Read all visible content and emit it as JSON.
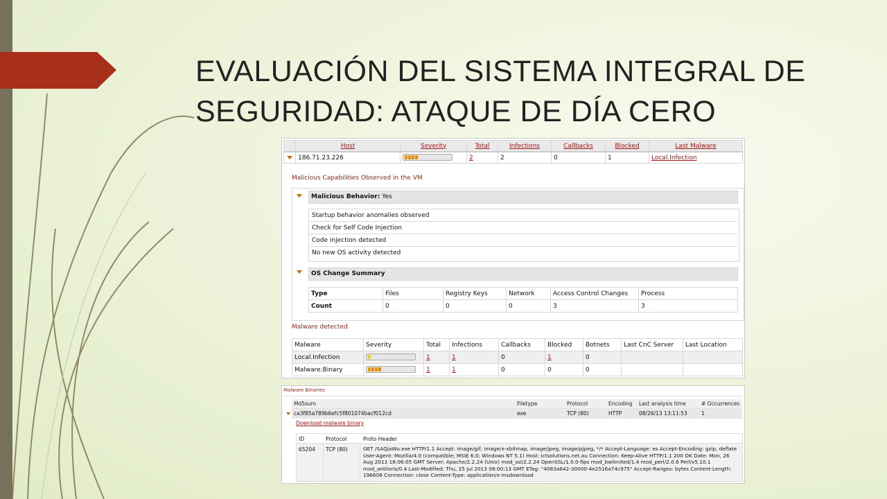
{
  "slide": {
    "title": "EVALUACIÓN DEL SISTEMA INTEGRAL DE SEGURIDAD: ATAQUE DE DÍA CERO",
    "accent_color": "#a8301a",
    "bar_color": "#77705a"
  },
  "host_table": {
    "headers": [
      "Host",
      "Severity",
      "Total",
      "Infections",
      "Callbacks",
      "Blocked",
      "Last Malware"
    ],
    "row": {
      "host": "186.71.23.226",
      "severity_level": 4,
      "total": "2",
      "infections": "2",
      "callbacks": "0",
      "blocked": "1",
      "last_malware": "Local.Infection"
    }
  },
  "malicious_section": {
    "label": "Malicious Capabilities Observed in the VM",
    "behavior_title": "Malicious Behavior:",
    "behavior_value": "Yes",
    "items": [
      "Startup behavior anomalies observed",
      "Check for Self Code Injection",
      "Code injection detected",
      "No new OS activity detected"
    ],
    "os_title": "OS Change Summary",
    "os_headers": [
      "Type",
      "Files",
      "Registry Keys",
      "Network",
      "Access Control Changes",
      "Process"
    ],
    "os_values": [
      "Count",
      "0",
      "0",
      "0",
      "3",
      "3"
    ]
  },
  "malware_section": {
    "label": "Malware detected",
    "headers": [
      "Malware",
      "Severity",
      "Total",
      "Infections",
      "Callbacks",
      "Blocked",
      "Botnets",
      "Last CnC Server",
      "Last Location"
    ],
    "rows": [
      {
        "malware": "Local.Infection",
        "severity_level": 1,
        "total": "1",
        "infections": "1",
        "callbacks": "0",
        "blocked": "1",
        "botnets": "0"
      },
      {
        "malware": "Malware.Binary",
        "severity_level": 4,
        "total": "1",
        "infections": "1",
        "callbacks": "0",
        "blocked": "0",
        "botnets": "0"
      }
    ]
  },
  "binaries": {
    "label": "Malware Binaries",
    "headers": [
      "Md5sum",
      "Filetype",
      "Protocol",
      "Encoding",
      "Last analysis time",
      "# Occurrences"
    ],
    "row": {
      "md5": "ca3f85a789b6efc5f801074bacf012cd",
      "filetype": "exe",
      "protocol": "TCP (80)",
      "encoding": "HTTP",
      "time": "08/26/13 13:11:53",
      "occurrences": "1"
    },
    "download_link": "Download malware binary",
    "detail_headers": [
      "ID",
      "Protocol",
      "Proto Header"
    ],
    "detail": {
      "id": "65204",
      "protocol": "TCP (80)",
      "header": "GET /SAQjaWu.exe HTTP/1.1 Accept: image/gif, image/x-xbitmap, image/jpeg, image/pjpeg, */* Accept-Language: es Accept-Encoding: gzip, deflate User-Agent: Mozilla/4.0 (compatible; MSIE 6.0; Windows NT 5.1) Host: ictsolutions.net.au Connection: Keep-Alive HTTP/1.1 200 OK Date: Mon, 26 Aug 2013 18:06:05 GMT Server: Apache/2.2.24 (Unix) mod_ssl/2.2.24 OpenSSL/1.0.0-fips mod_bwlimited/1.4 mod_perl/2.0.6 Perl/v5.10.1 mod_antiloris/0.4 Last-Modified: Thu, 25 Jul 2013 08:00:13 GMT ETag: \"4083a642-30000-4e2516a74c975\" Accept-Ranges: bytes Content-Length: 196608 Connection: close Content-Type: application/x-msdownload"
    }
  }
}
